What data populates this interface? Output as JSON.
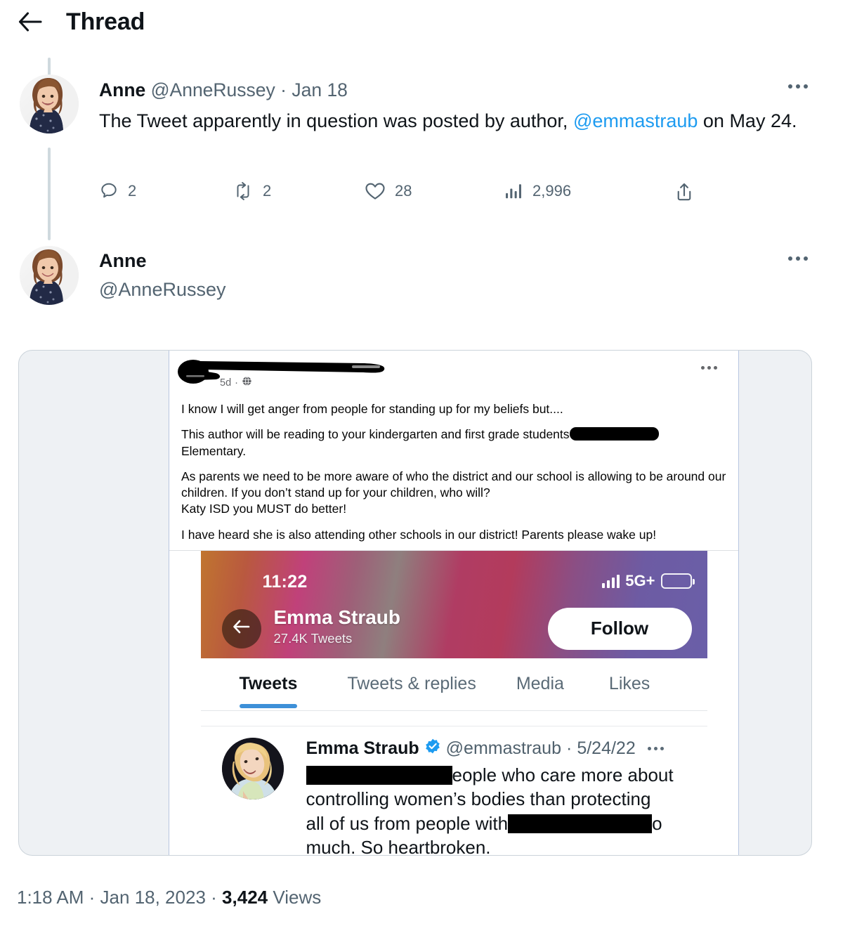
{
  "header": {
    "title": "Thread",
    "back_icon": "arrow-left-icon"
  },
  "tweets": [
    {
      "display_name": "Anne",
      "handle": "@AnneRussey",
      "separator": "·",
      "date": "Jan 18",
      "body_part1": "The Tweet apparently in question was posted by author, ",
      "body_mention": "@emmastraub",
      "body_part2": " on May 24.",
      "actions": {
        "reply_count": "2",
        "retweet_count": "2",
        "like_count": "28",
        "view_count": "2,996",
        "share_icon": "share-icon"
      }
    },
    {
      "display_name": "Anne",
      "handle": "@AnneRussey"
    }
  ],
  "media_card": {
    "facebook_post": {
      "time_ago": "5d",
      "meta_separator": "·",
      "audience_icon": "globe-icon",
      "paragraphs": [
        "I know I will get anger from people for standing up for my beliefs but....",
        "This author will be reading to your kindergarten and first grade students",
        "Elementary.",
        "As parents we need to be more aware of who the district and our school is allowing to be around our children. If you don’t stand up for your children, who will?",
        "Katy ISD you MUST do better!",
        "I have heard she is also attending other schools in our district! Parents please wake up!"
      ]
    },
    "phone_screenshot": {
      "status_bar": {
        "time": "11:22",
        "network": "5G+",
        "signal_icon": "signal-bars-icon",
        "battery_icon": "battery-icon"
      },
      "profile": {
        "back_icon": "arrow-left-icon",
        "name": "Emma Straub",
        "tweet_count": "27.4K Tweets",
        "follow_label": "Follow"
      },
      "tabs": [
        {
          "label": "Tweets",
          "active": true
        },
        {
          "label": "Tweets & replies",
          "active": false
        },
        {
          "label": "Media",
          "active": false
        },
        {
          "label": "Likes",
          "active": false
        }
      ],
      "tweet": {
        "name": "Emma Straub",
        "verified_icon": "verified-badge-icon",
        "handle": "@emmastraub",
        "separator": "·",
        "date": "5/24/22",
        "line1_after_redaction": "eople who care more about",
        "line2": "controlling women’s bodies than protecting",
        "line3_prefix": "all of us from people with",
        "line3_suffix": "o",
        "line4": "much. So heartbroken."
      }
    }
  },
  "footer": {
    "time": "1:18 AM",
    "sep1": "·",
    "date": "Jan 18, 2023",
    "sep2": "·",
    "views_count": "3,424",
    "views_label": "Views"
  },
  "colors": {
    "accent": "#1d9bf0",
    "text_primary": "#0f1419",
    "text_secondary": "#536471",
    "thread_line": "#cfd9de",
    "card_bg": "#eef1f4",
    "verified_blue": "#1d9bf0"
  }
}
